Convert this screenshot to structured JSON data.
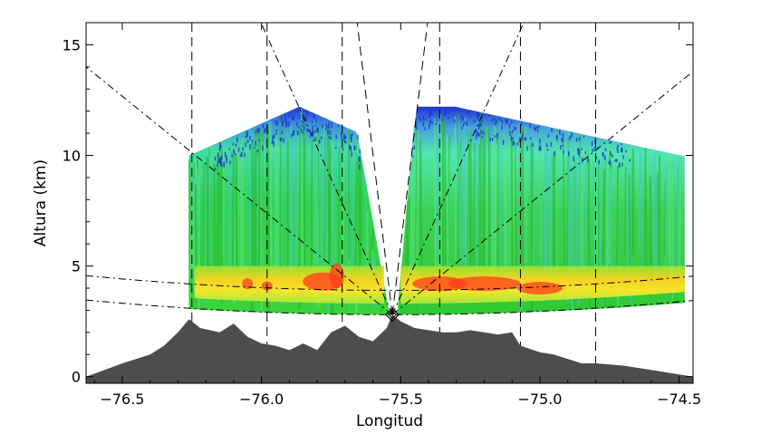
{
  "chart_data": {
    "type": "heatmap",
    "title": "",
    "xlabel": "Longitud",
    "ylabel": "Altura (km)",
    "xlim": [
      -76.63,
      -74.45
    ],
    "ylim": [
      -0.3,
      16.0
    ],
    "x_ticks": [
      -76.5,
      -76.0,
      -75.5,
      -75.0,
      -74.5
    ],
    "x_tick_labels": [
      "−76.5",
      "−76.0",
      "−75.5",
      "−75.0",
      "−74.5"
    ],
    "y_ticks": [
      0,
      5,
      10,
      15
    ],
    "y_tick_labels": [
      "0",
      "5",
      "10",
      "15"
    ],
    "grid": false,
    "radar_site": {
      "lon": -75.53,
      "alt_km": 2.8
    },
    "terrain_profile": {
      "lon": [
        -76.63,
        -76.5,
        -76.4,
        -76.35,
        -76.3,
        -76.26,
        -76.22,
        -76.15,
        -76.1,
        -76.05,
        -76.0,
        -75.95,
        -75.9,
        -75.85,
        -75.8,
        -75.75,
        -75.7,
        -75.65,
        -75.6,
        -75.55,
        -75.53,
        -75.5,
        -75.45,
        -75.4,
        -75.35,
        -75.3,
        -75.25,
        -75.2,
        -75.15,
        -75.1,
        -75.07,
        -75.0,
        -74.95,
        -74.9,
        -74.85,
        -74.8,
        -74.7,
        -74.6,
        -74.5,
        -74.45
      ],
      "alt_km": [
        0.0,
        0.6,
        1.0,
        1.4,
        2.0,
        2.6,
        2.2,
        2.0,
        2.4,
        1.8,
        1.5,
        1.4,
        1.2,
        1.5,
        1.2,
        2.0,
        2.3,
        1.8,
        1.6,
        2.2,
        2.8,
        2.5,
        2.2,
        2.1,
        2.0,
        2.0,
        2.1,
        2.0,
        1.9,
        2.0,
        1.4,
        1.1,
        1.0,
        0.8,
        0.6,
        0.6,
        0.5,
        0.3,
        0.1,
        0.0
      ]
    },
    "scan_guides": {
      "vertical_lon": [
        -76.25,
        -75.98,
        -75.71,
        -75.36,
        -75.07,
        -74.8
      ],
      "elevation_rays_deg": [
        20,
        45,
        75
      ]
    },
    "reflectivity_regions": [
      {
        "name": "echo-west-cloud",
        "color": "#2ecc40",
        "lon_range": [
          -76.26,
          -75.54
        ],
        "top_km": [
          10.5,
          12.2
        ]
      },
      {
        "name": "echo-east-cloud",
        "color": "#2ecc40",
        "lon_range": [
          -75.51,
          -74.48
        ],
        "top_km": [
          10.0,
          12.2
        ]
      },
      {
        "name": "bright-band",
        "color": "#ffd21e",
        "alt_km": [
          3.8,
          4.8
        ]
      },
      {
        "name": "echo-top",
        "color": "#1e32d2",
        "alt_km": [
          11.0,
          12.3
        ]
      }
    ],
    "colors": {
      "terrain": "#4d4d4d",
      "low_echo": "#28d228",
      "mid_echo": "#46e6a0",
      "high_echo": "#1e32d2",
      "bright_band": "#ffd21e",
      "core": "#ff3c1e"
    }
  }
}
